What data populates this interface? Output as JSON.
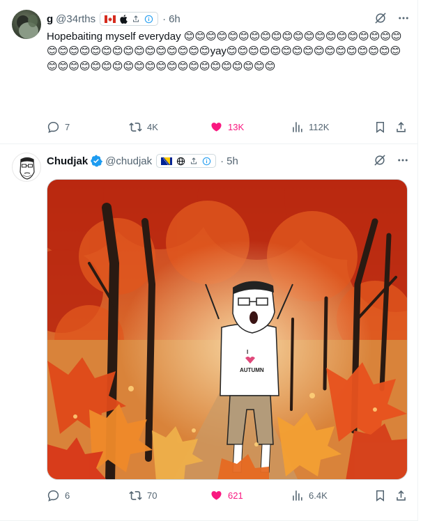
{
  "colors": {
    "like": "#f91880",
    "muted": "#536471",
    "border": "#cfd9de"
  },
  "tweets": [
    {
      "author": {
        "name": "g",
        "handle": "@34rths",
        "avatar_icon": "profile-photo"
      },
      "badges": [
        "canada-flag-icon",
        "apple-icon",
        "share-icon",
        "info-icon"
      ],
      "separator": "·",
      "time": "6h",
      "text_before": "Hopebaiting myself everyday ",
      "text_after_yay": "",
      "emoji": "😊",
      "emoji_before_yay": 35,
      "yay": "yay",
      "emoji_after_yay": 37,
      "actions": {
        "reply": "7",
        "retweet": "4K",
        "like": "13K",
        "views": "112K"
      },
      "liked": true
    },
    {
      "author": {
        "name": "Chudjak",
        "handle": "@chudjak",
        "verified": true,
        "avatar_icon": "wojak-avatar"
      },
      "badges": [
        "bosnia-flag-icon",
        "globe-icon",
        "share-icon",
        "info-icon"
      ],
      "separator": "·",
      "time": "5h",
      "media": {
        "shirt_heart": "I",
        "shirt_word": "AUTUMN"
      },
      "actions": {
        "reply": "6",
        "retweet": "70",
        "like": "621",
        "views": "6.4K"
      },
      "liked": true
    }
  ]
}
